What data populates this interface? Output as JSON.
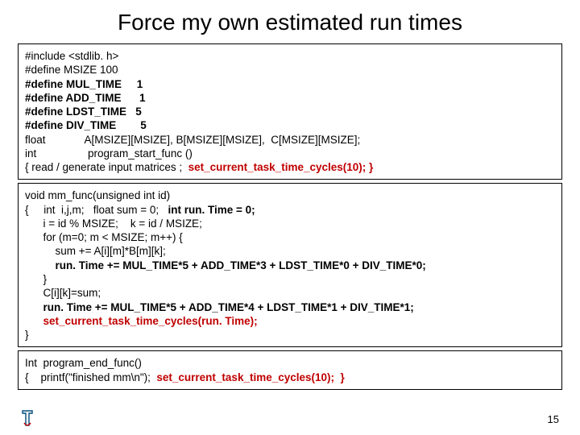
{
  "title": "Force my own estimated run times",
  "box1": {
    "l1": "#include <stdlib. h>",
    "l2": "#define MSIZE 100",
    "l3": "#define MUL_TIME     1",
    "l4": "#define ADD_TIME      1",
    "l5": "#define LDST_TIME   5",
    "l6": "#define DIV_TIME        5",
    "l7a": "float             A[MSIZE][MSIZE], B[MSIZE][MSIZE],  C[MSIZE][MSIZE];",
    "l8a": "int                 program_start_func ()",
    "l9a": "{ read / generate input matrices ;  ",
    "l9b": "set_current_task_time_cycles(10); }"
  },
  "box2": {
    "l1": "void mm_func(unsigned int id)",
    "l2a": "{     int  i,j,m;   float sum = 0;   int run. Time = 0;",
    "l3": "      i = id % MSIZE;    k = id / MSIZE;",
    "l4": "      for (m=0; m < MSIZE; m++) {",
    "l5": "          sum += A[i][m]*B[m][k];",
    "l6": "          run. Time += MUL_TIME*5 + ADD_TIME*3 + LDST_TIME*0 + DIV_TIME*0;",
    "l7": "      }",
    "l8": "      C[i][k]=sum;",
    "l9": "      run. Time += MUL_TIME*5 + ADD_TIME*4 + LDST_TIME*1 + DIV_TIME*1;",
    "l10": "      set_current_task_time_cycles(run. Time);",
    "l11": "}"
  },
  "box3": {
    "l1": "Int  program_end_func()",
    "l2a": "{    printf(\"finished mm\\n\"); ",
    "l2b": " set_current_task_time_cycles(10);  }"
  },
  "page": "15"
}
